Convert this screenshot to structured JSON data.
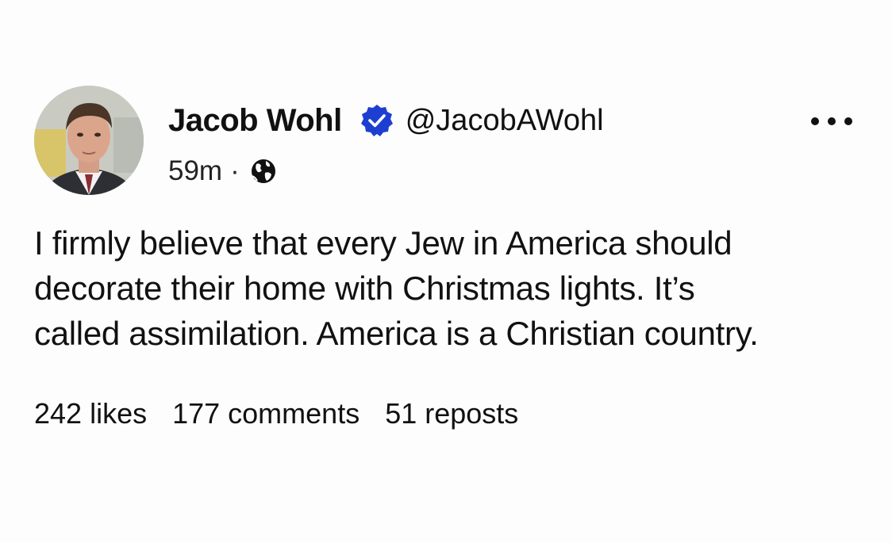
{
  "author": {
    "display_name": "Jacob Wohl",
    "handle": "@JacobAWohl",
    "verified": true,
    "verified_color": "#1d3fd1"
  },
  "post": {
    "timestamp": "59m",
    "separator": "·",
    "visibility_icon": "globe-icon",
    "text_lines": [
      "I firmly believe that every Jew in America should",
      "decorate their home with Christmas lights. It’s",
      "called assimilation. America is a Christian country."
    ]
  },
  "stats": {
    "likes": "242 likes",
    "comments": "177 comments",
    "reposts": "51 reposts"
  },
  "icons": {
    "more": "more-options-icon",
    "verified": "verified-badge-icon"
  }
}
